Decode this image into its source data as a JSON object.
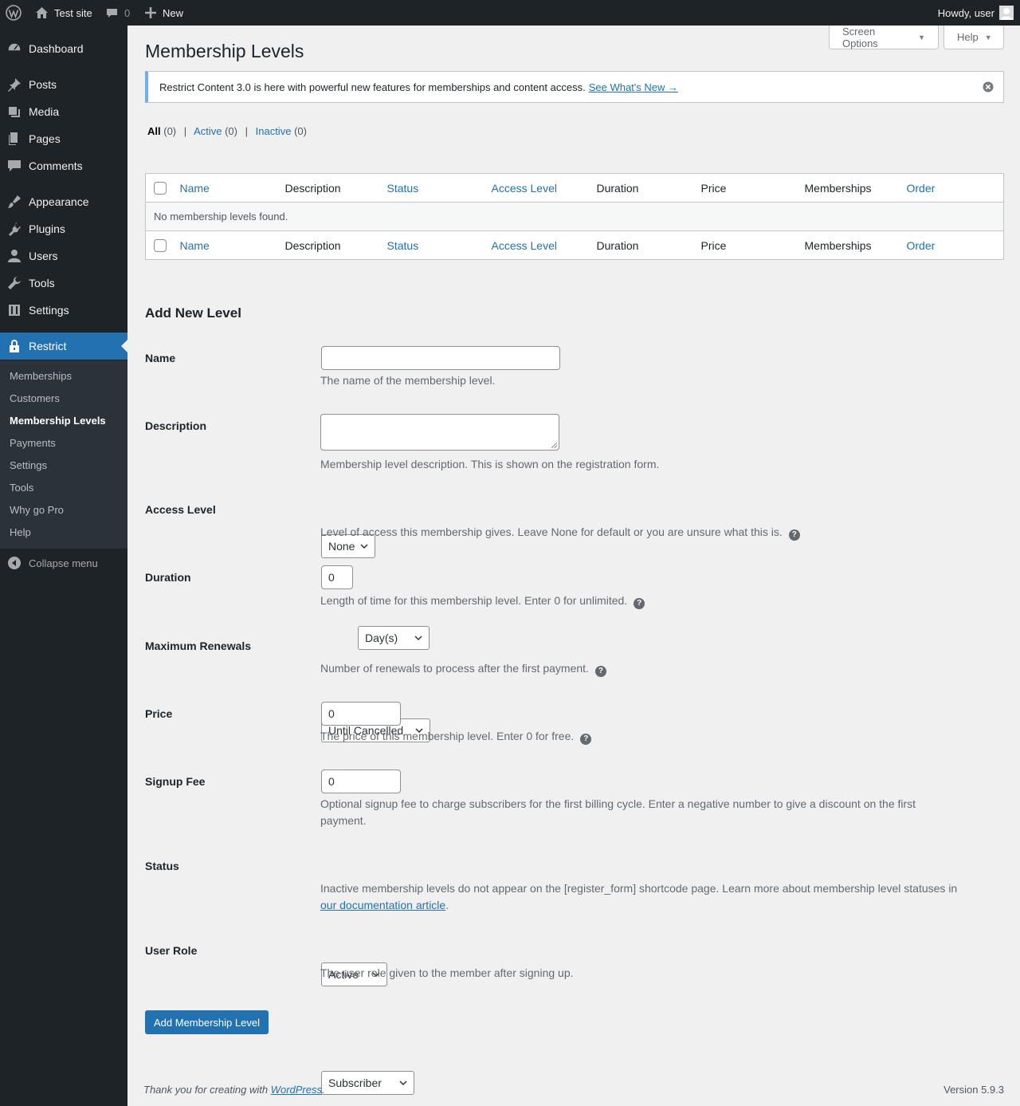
{
  "admin_bar": {
    "site_name": "Test site",
    "comments_count": "0",
    "new_label": "New",
    "howdy": "Howdy, user"
  },
  "menu": {
    "items": [
      {
        "label": "Dashboard",
        "icon": "dashboard-icon"
      },
      {
        "label": "Posts",
        "icon": "pin-icon"
      },
      {
        "label": "Media",
        "icon": "media-icon"
      },
      {
        "label": "Pages",
        "icon": "pages-icon"
      },
      {
        "label": "Comments",
        "icon": "comment-icon"
      },
      {
        "label": "Appearance",
        "icon": "brush-icon"
      },
      {
        "label": "Plugins",
        "icon": "plug-icon"
      },
      {
        "label": "Users",
        "icon": "user-icon"
      },
      {
        "label": "Tools",
        "icon": "wrench-icon"
      },
      {
        "label": "Settings",
        "icon": "sliders-icon"
      },
      {
        "label": "Restrict",
        "icon": "lock-icon"
      }
    ],
    "submenu": [
      "Memberships",
      "Customers",
      "Membership Levels",
      "Payments",
      "Settings",
      "Tools",
      "Why go Pro",
      "Help"
    ],
    "collapse": "Collapse menu"
  },
  "page": {
    "title": "Membership Levels",
    "screen_options": "Screen Options",
    "help": "Help"
  },
  "notice": {
    "text": "Restrict Content 3.0 is here with powerful new features for memberships and content access.",
    "link": "See What's New →"
  },
  "filters": {
    "all": "All",
    "all_count": "(0)",
    "active": "Active",
    "active_count": "(0)",
    "inactive": "Inactive",
    "inactive_count": "(0)",
    "sep": "|"
  },
  "table": {
    "columns": [
      "Name",
      "Description",
      "Status",
      "Access Level",
      "Duration",
      "Price",
      "Memberships",
      "Order"
    ],
    "empty": "No membership levels found."
  },
  "form": {
    "heading": "Add New Level",
    "name": {
      "label": "Name",
      "value": "",
      "desc": "The name of the membership level."
    },
    "description": {
      "label": "Description",
      "desc": "Membership level description. This is shown on the registration form."
    },
    "access_level": {
      "label": "Access Level",
      "value": "None",
      "desc": "Level of access this membership gives. Leave None for default or you are unsure what this is."
    },
    "duration": {
      "label": "Duration",
      "value": "0",
      "unit": "Day(s)",
      "desc": "Length of time for this membership level. Enter 0 for unlimited."
    },
    "max_renewals": {
      "label": "Maximum Renewals",
      "value": "Until Cancelled",
      "desc": "Number of renewals to process after the first payment."
    },
    "price": {
      "label": "Price",
      "value": "0",
      "desc": "The price of this membership level. Enter 0 for free."
    },
    "signup_fee": {
      "label": "Signup Fee",
      "value": "0",
      "desc_line1": "Optional signup fee to charge subscribers for the first billing cycle. Enter a negative number to give a discount on the first",
      "desc_line2": "payment."
    },
    "status": {
      "label": "Status",
      "value": "Active",
      "desc_line1": "Inactive membership levels do not appear on the [register_form] shortcode page. Learn more about membership level statuses in",
      "desc_link": "our documentation article",
      "desc_end": "."
    },
    "user_role": {
      "label": "User Role",
      "value": "Subscriber",
      "desc": "The user role given to the member after signing up."
    },
    "submit": "Add Membership Level"
  },
  "footer": {
    "thanks": "Thank you for creating with",
    "wp_link": "WordPress",
    "period": ".",
    "version": "Version 5.9.3"
  },
  "colors": {
    "admin_bar_bg": "#1d2327",
    "menu_bg": "#1d2327",
    "submenu_bg": "#2c3338",
    "accent": "#2271b1",
    "notice_border": "#72aee6"
  }
}
